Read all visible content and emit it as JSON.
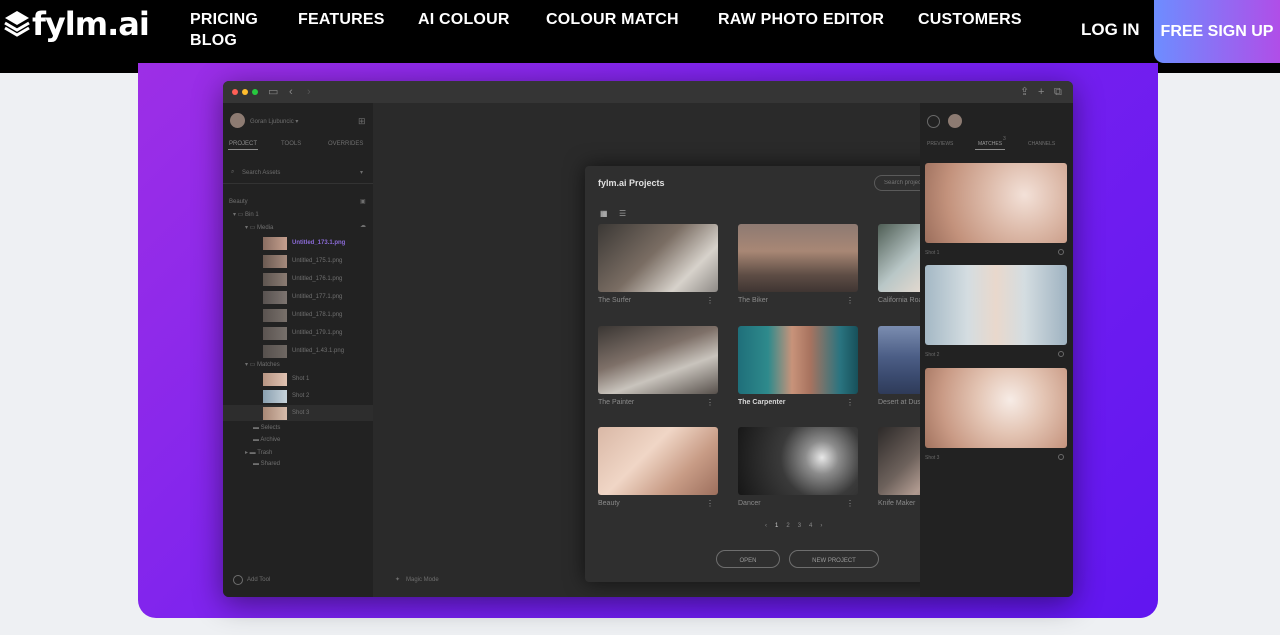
{
  "nav": {
    "logo_text": "fylm.ai",
    "links": [
      "PRICING",
      "FEATURES",
      "AI COLOUR",
      "COLOUR MATCH",
      "RAW PHOTO EDITOR",
      "CUSTOMERS"
    ],
    "blog": "BLOG",
    "login": "LOG IN",
    "signup": "FREE SIGN UP"
  },
  "app": {
    "user_name": "Goran Ljubuncic ▾",
    "left_tabs": [
      "PROJECT",
      "TOOLS",
      "OVERRIDES"
    ],
    "search_assets": "Search Assets",
    "tree": {
      "root": "Beauty",
      "bin": "Bin 1",
      "media": "Media",
      "files": [
        "Untitled_173.1.png",
        "Untitled_175.1.png",
        "Untitled_176.1.png",
        "Untitled_177.1.png",
        "Untitled_178.1.png",
        "Untitled_179.1.png",
        "Untitled_1.43.1.png"
      ],
      "matches": "Matches",
      "shots": [
        "Shot 1",
        "Shot 2",
        "Shot 3"
      ],
      "folders": [
        "Selects",
        "Archive",
        "Trash",
        "Shared"
      ]
    },
    "add_tool": "Add Tool",
    "magic_mode": "Magic Mode",
    "right_tabs": [
      "PREVIEWS",
      "MATCHES",
      "CHANNELS"
    ],
    "matches_badge": "3",
    "right_shots": [
      "Shot 1",
      "Shot 2",
      "Shot 3"
    ]
  },
  "modal": {
    "title": "fylm.ai Projects",
    "search_placeholder": "Search projects",
    "projects": [
      "The Surfer",
      "The Biker",
      "California Road Trip",
      "The Painter",
      "The Carpenter",
      "Desert at Dusk",
      "Beauty",
      "Dancer",
      "Knife Maker"
    ],
    "pages": [
      "‹",
      "1",
      "2",
      "3",
      "4",
      "›"
    ],
    "open": "OPEN",
    "new_project": "NEW PROJECT"
  }
}
